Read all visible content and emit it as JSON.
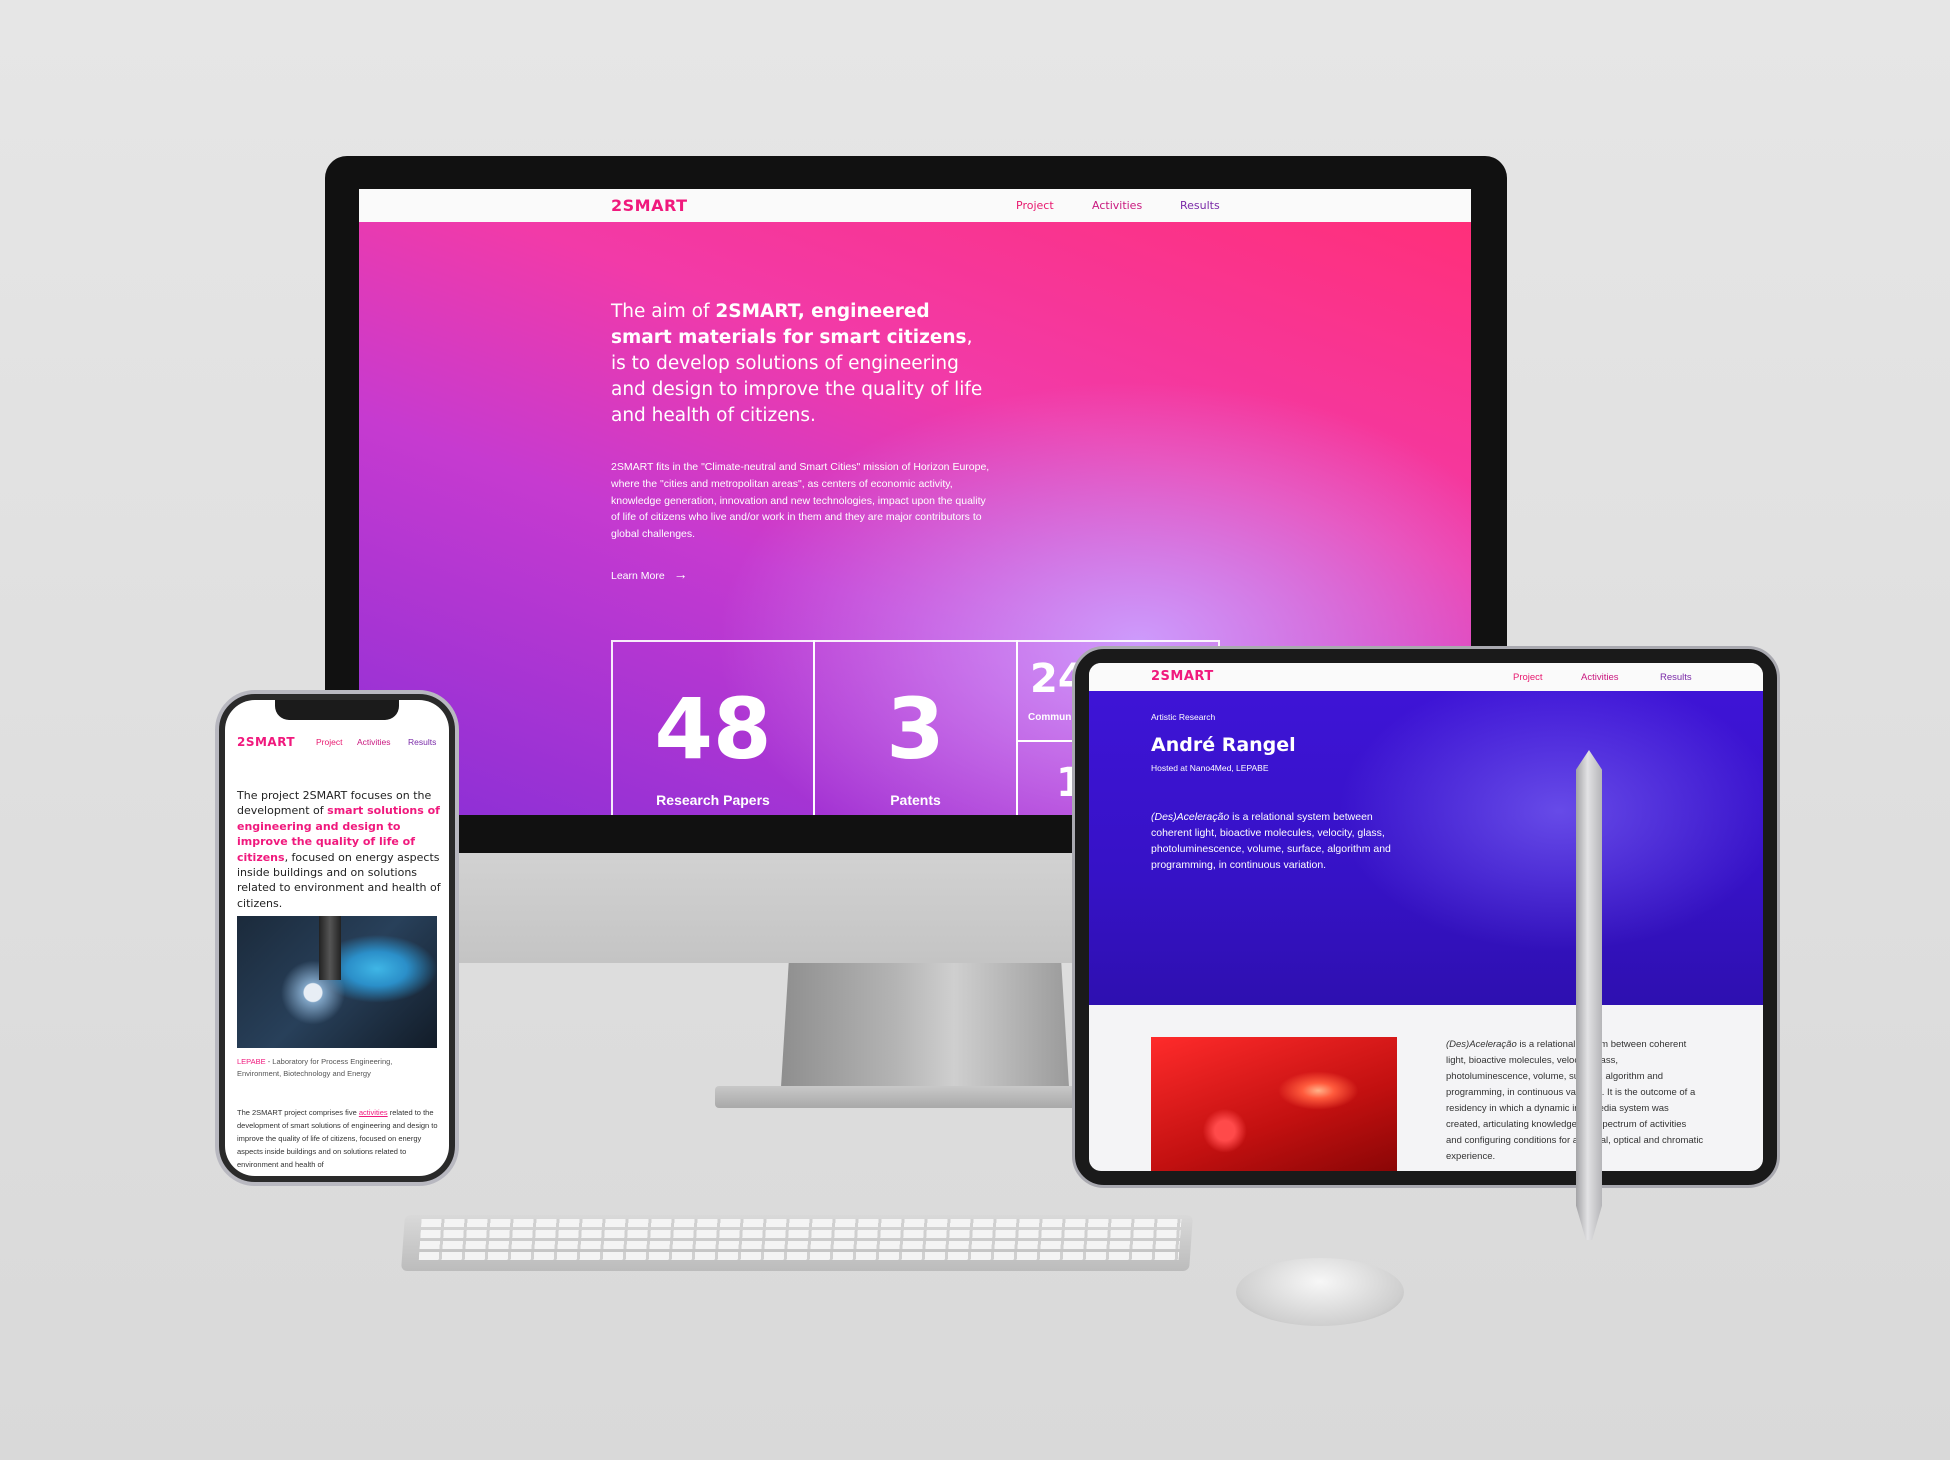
{
  "desktop": {
    "brand": "2SMART",
    "nav": [
      "Project",
      "Activities",
      "Results"
    ],
    "headline_pre": "The aim of ",
    "headline_bold": "2SMART, engineered smart materials for smart citizens",
    "headline_post": ", is to develop solutions of engineering and design to improve the quality of life and health of citizens.",
    "paragraph": "2SMART fits in the \"Climate-neutral and Smart Cities\" mission of Horizon Europe, where the \"cities and metropolitan areas\", as centers of economic activity, knowledge generation, innovation and new technologies, impact upon the quality of life of citizens who live and/or work in them and they are major contributors to global challenges.",
    "learn_more": "Learn More",
    "stats": [
      {
        "value": "48",
        "label": "Research Papers"
      },
      {
        "value": "3",
        "label": "Patents"
      },
      {
        "value": "24",
        "label": "Commun"
      },
      {
        "value": "1",
        "label": ""
      }
    ]
  },
  "phone": {
    "brand": "2SMART",
    "nav": [
      "Project",
      "Activities",
      "Results"
    ],
    "intro_pre": "The project 2SMART focuses on the development of ",
    "intro_highlight": "smart solutions of engineering and design to improve the quality of life of citizens",
    "intro_post": ", focused on energy aspects inside buildings and on solutions related to environment and health of citizens.",
    "caption_highlight": "LEPABE",
    "caption_rest": " - Laboratory for Process Engineering, Environment, Biotechnology and Energy",
    "body_pre": "The 2SMART project comprises five ",
    "body_link": "activities",
    "body_post": " related to the development of smart solutions of engineering and design to improve the quality of life of citizens, focused on energy aspects inside buildings and on solutions related to environment and health of"
  },
  "tablet": {
    "brand": "2SMART",
    "nav": [
      "Project",
      "Activities",
      "Results"
    ],
    "eyebrow": "Artistic Research",
    "title": "André Rangel",
    "hosted": "Hosted at Nano4Med, LEPABE",
    "desc_italic": "(Des)Aceleração",
    "desc_rest": " is a relational system between coherent light, bioactive molecules, velocity, glass, photoluminescence, volume, surface, algorithm and programming, in continuous variation.",
    "body_italic": "(Des)Aceleração",
    "body_rest": " is a relational system between coherent light, bioactive molecules, velocity, glass, photoluminescence, volume, surface, algorithm and programming, in continuous variation. It is the outcome of a residency in which a dynamic intermedia system was created, articulating knowledge in a spectrum of activities and configuring conditions for a spatial, optical and chromatic experience."
  }
}
